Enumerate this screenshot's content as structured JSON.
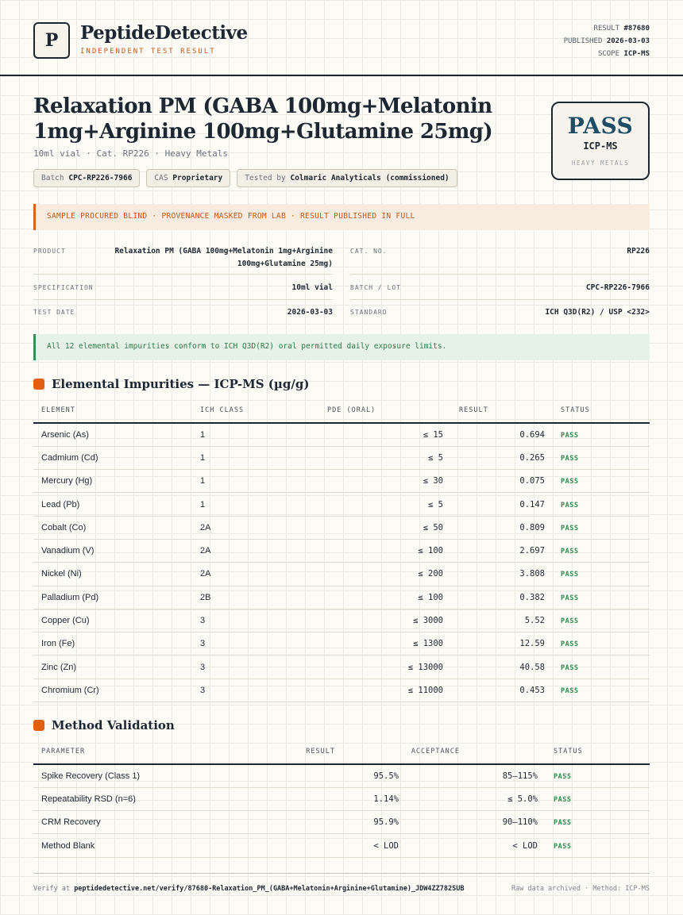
{
  "brand": {
    "logo_letter": "P",
    "name": "PeptideDetective",
    "tagline": "INDEPENDENT TEST RESULT"
  },
  "meta": {
    "result_label": "RESULT",
    "result_value": "#87680",
    "published_label": "PUBLISHED",
    "published_value": "2026-03-03",
    "scope_label": "SCOPE",
    "scope_value": "ICP-MS"
  },
  "title": "Relaxation PM (GABA 100mg+Melatonin 1mg+Arginine 100mg+Glutamine 25mg)",
  "subtitle": "10ml vial · Cat. RP226 · Heavy Metals",
  "chips": [
    {
      "label": "Batch",
      "value": "CPC-RP226-7966"
    },
    {
      "label": "CAS",
      "value": "Proprietary"
    },
    {
      "label": "Tested by",
      "value": "Colmaric Analyticals (commissioned)"
    }
  ],
  "verdict": {
    "word": "PASS",
    "method": "ICP-MS",
    "scope": "HEAVY METALS",
    "color": "#1f4d66"
  },
  "warning": "SAMPLE PROCURED BLIND · PROVENANCE MASKED FROM LAB · RESULT PUBLISHED IN FULL",
  "info": {
    "product_label": "PRODUCT",
    "product_value": "Relaxation PM (GABA 100mg+Melatonin 1mg+Arginine 100mg+Glutamine 25mg)",
    "cat_label": "CAT. NO.",
    "cat_value": "RP226",
    "spec_label": "SPECIFICATION",
    "spec_value": "10ml vial",
    "batch_label": "BATCH / LOT",
    "batch_value": "CPC-RP226-7966",
    "date_label": "TEST DATE",
    "date_value": "2026-03-03",
    "standard_label": "STANDARD",
    "standard_value": "ICH Q3D(R2) / USP <232>"
  },
  "conformance": "All 12 elemental impurities conform to ICH Q3D(R2) oral permitted daily exposure limits.",
  "impurities": {
    "heading": "Elemental Impurities — ICP-MS (µg/g)",
    "columns": [
      "ELEMENT",
      "ICH CLASS",
      "PDE (ORAL)",
      "RESULT",
      "STATUS"
    ],
    "rows": [
      {
        "element": "Arsenic (As)",
        "class": "1",
        "pde": "≤ 15",
        "result": "0.694",
        "status": "PASS"
      },
      {
        "element": "Cadmium (Cd)",
        "class": "1",
        "pde": "≤ 5",
        "result": "0.265",
        "status": "PASS"
      },
      {
        "element": "Mercury (Hg)",
        "class": "1",
        "pde": "≤ 30",
        "result": "0.075",
        "status": "PASS"
      },
      {
        "element": "Lead (Pb)",
        "class": "1",
        "pde": "≤ 5",
        "result": "0.147",
        "status": "PASS"
      },
      {
        "element": "Cobalt (Co)",
        "class": "2A",
        "pde": "≤ 50",
        "result": "0.809",
        "status": "PASS"
      },
      {
        "element": "Vanadium (V)",
        "class": "2A",
        "pde": "≤ 100",
        "result": "2.697",
        "status": "PASS"
      },
      {
        "element": "Nickel (Ni)",
        "class": "2A",
        "pde": "≤ 200",
        "result": "3.808",
        "status": "PASS"
      },
      {
        "element": "Palladium (Pd)",
        "class": "2B",
        "pde": "≤ 100",
        "result": "0.382",
        "status": "PASS"
      },
      {
        "element": "Copper (Cu)",
        "class": "3",
        "pde": "≤ 3000",
        "result": "5.52",
        "status": "PASS"
      },
      {
        "element": "Iron (Fe)",
        "class": "3",
        "pde": "≤ 1300",
        "result": "12.59",
        "status": "PASS"
      },
      {
        "element": "Zinc (Zn)",
        "class": "3",
        "pde": "≤ 13000",
        "result": "40.58",
        "status": "PASS"
      },
      {
        "element": "Chromium (Cr)",
        "class": "3",
        "pde": "≤ 11000",
        "result": "0.453",
        "status": "PASS"
      }
    ]
  },
  "validation": {
    "heading": "Method Validation",
    "columns": [
      "PARAMETER",
      "RESULT",
      "ACCEPTANCE",
      "STATUS"
    ],
    "rows": [
      {
        "parameter": "Spike Recovery (Class 1)",
        "result": "95.5%",
        "acceptance": "85–115%",
        "status": "PASS"
      },
      {
        "parameter": "Repeatability RSD (n=6)",
        "result": "1.14%",
        "acceptance": "≤ 5.0%",
        "status": "PASS"
      },
      {
        "parameter": "CRM Recovery",
        "result": "95.9%",
        "acceptance": "90–110%",
        "status": "PASS"
      },
      {
        "parameter": "Method Blank",
        "result": "< LOD",
        "acceptance": "< LOD",
        "status": "PASS"
      }
    ]
  },
  "footer": {
    "verify_label": "Verify at",
    "verify_url": "peptidedetective.net/verify/87680-Relaxation_PM_(GABA+Melatonin+Arginine+Glutamine)_JDW4ZZ782SUB",
    "archive": "Raw data archived · Method: ICP-MS"
  },
  "colors": {
    "ink": "#1d2731",
    "accent": "#e15f14",
    "pass_green": "#2e8a4f",
    "verdict_blue": "#1f4d66"
  }
}
